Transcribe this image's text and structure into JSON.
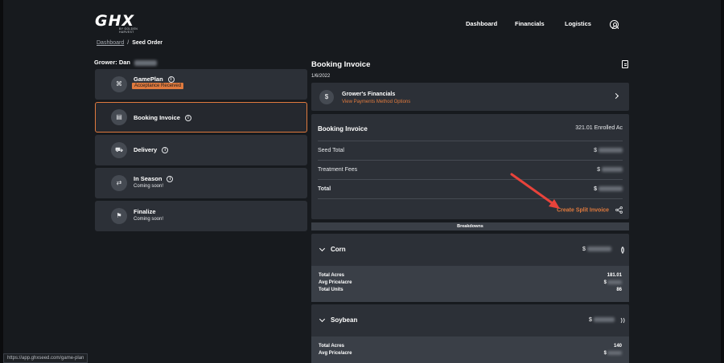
{
  "header": {
    "logo_text": "GHX",
    "logo_subtext": "BY GOLDEN HARVEST",
    "nav": [
      "Dashboard",
      "Financials",
      "Logistics"
    ]
  },
  "breadcrumb": {
    "link": "Dashboard",
    "separator": "/",
    "current": "Seed Order"
  },
  "grower": {
    "label": "Grower: Dan"
  },
  "steps": [
    {
      "title": "GamePlan",
      "badge": "Acceptance Received",
      "icon": "gameplan-icon",
      "glyph": "⌘"
    },
    {
      "title": "Booking Invoice",
      "icon": "invoice-icon",
      "glyph": "▤"
    },
    {
      "title": "Delivery",
      "icon": "truck-icon",
      "glyph": "⛟"
    },
    {
      "title": "In Season",
      "sub": "Coming soon!",
      "icon": "cycle-icon",
      "glyph": "⇄"
    },
    {
      "title": "Finalize",
      "sub": "Coming soon!",
      "icon": "flag-icon",
      "glyph": "⚑"
    }
  ],
  "invoice": {
    "title": "Booking Invoice",
    "date": "1/6/2022",
    "financials": {
      "icon_glyph": "$",
      "title": "Grower's Financials",
      "link": "View Payments Method Options"
    },
    "summary": {
      "title": "Booking Invoice",
      "enrolled": "321.01 Enrolled Ac",
      "rows": [
        {
          "label": "Seed Total",
          "value": "$"
        },
        {
          "label": "Treatment Fees",
          "value": "$"
        },
        {
          "label": "Total",
          "value": "$"
        }
      ],
      "split_label": "Create Split Invoice"
    },
    "breakdowns_label": "Breakdowns",
    "crops": [
      {
        "name": "Corn",
        "amount": "$",
        "rows": [
          {
            "label": "Total Acres",
            "value": "181.01"
          },
          {
            "label": "Avg Price/acre",
            "value": "$"
          },
          {
            "label": "Total Units",
            "value": "86"
          }
        ]
      },
      {
        "name": "Soybean",
        "amount": "$",
        "rows": [
          {
            "label": "Total Acres",
            "value": "140"
          },
          {
            "label": "Avg Price/acre",
            "value": "$"
          }
        ]
      }
    ]
  },
  "status_bar": {
    "url": "https://app.ghxseed.com/game-plan"
  },
  "colors": {
    "accent": "#e07a3e",
    "card": "#2c3037",
    "background": "#171a1e",
    "arrow": "#e8433b"
  }
}
